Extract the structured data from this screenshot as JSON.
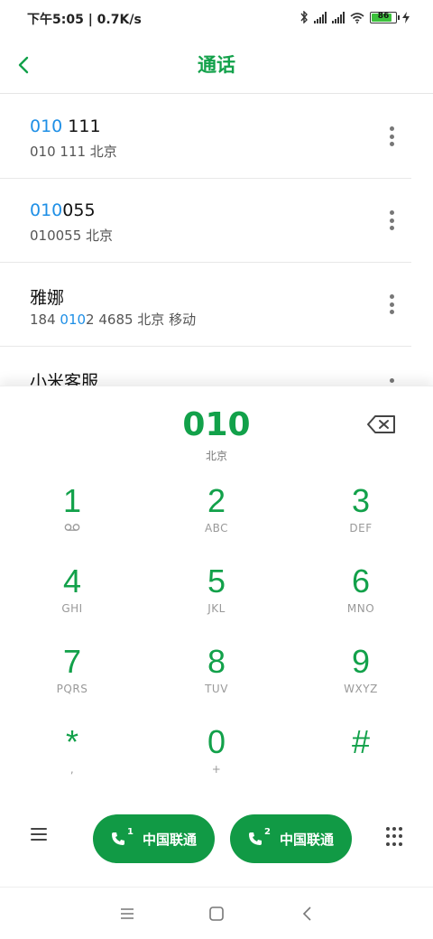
{
  "status_bar": {
    "time_speed": "下午5:05 | 0.7K/s",
    "battery": "86",
    "icons": [
      "bluetooth-icon",
      "signal-icon",
      "signal-icon",
      "wifi-icon",
      "battery-icon",
      "charging-icon"
    ]
  },
  "header": {
    "title": "通话",
    "back_icon": "back-arrow-icon"
  },
  "contacts": [
    {
      "name_hl": "010",
      "name_rest": " 111",
      "sub_pre": "",
      "sub_hl": "",
      "sub_rest": "010 111 北京"
    },
    {
      "name_hl": "010",
      "name_rest": "055",
      "sub_pre": "",
      "sub_hl": "",
      "sub_rest": "010055 北京"
    },
    {
      "name_hl": "",
      "name_rest": "雅娜",
      "sub_pre": "184 ",
      "sub_hl": "010",
      "sub_rest": "2 4685 北京 移动"
    },
    {
      "name_hl": "",
      "name_rest": "小米客服",
      "sub_pre": "",
      "sub_hl": "",
      "sub_rest": ""
    }
  ],
  "dialer": {
    "number": "010",
    "location": "北京",
    "keys": [
      {
        "digit": "1",
        "letters": ""
      },
      {
        "digit": "2",
        "letters": "ABC"
      },
      {
        "digit": "3",
        "letters": "DEF"
      },
      {
        "digit": "4",
        "letters": "GHI"
      },
      {
        "digit": "5",
        "letters": "JKL"
      },
      {
        "digit": "6",
        "letters": "MNO"
      },
      {
        "digit": "7",
        "letters": "PQRS"
      },
      {
        "digit": "8",
        "letters": "TUV"
      },
      {
        "digit": "9",
        "letters": "WXYZ"
      },
      {
        "digit": "*",
        "letters": ","
      },
      {
        "digit": "0",
        "letters": "+"
      },
      {
        "digit": "#",
        "letters": ""
      }
    ],
    "call_buttons": [
      {
        "sim": "1",
        "label": "中国联通"
      },
      {
        "sim": "2",
        "label": "中国联通"
      }
    ]
  },
  "colors": {
    "accent": "#12a14a",
    "call_button": "#119a45",
    "highlight": "#1e8fe6"
  }
}
